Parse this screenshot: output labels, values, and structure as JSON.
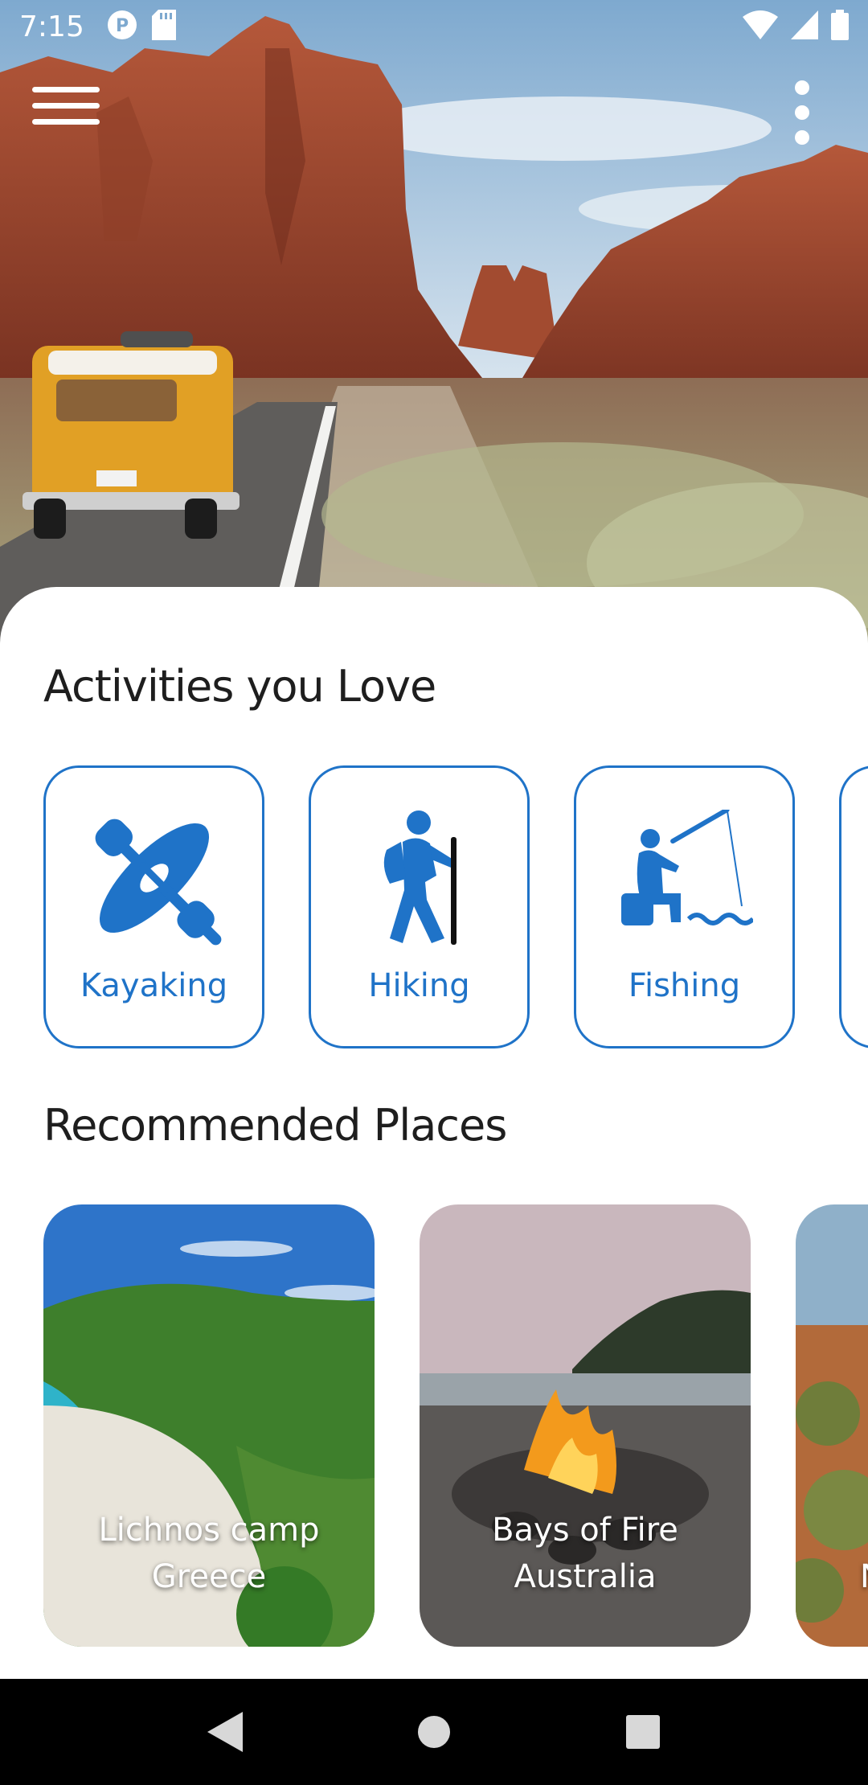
{
  "status_bar": {
    "time": "7:15",
    "icons": [
      "p-notification-icon",
      "sd-card-icon",
      "wifi-icon",
      "signal-icon",
      "battery-icon"
    ]
  },
  "colors": {
    "accent": "#1f73c8",
    "text": "#1e1e1e",
    "sheet": "#ffffff"
  },
  "sections": {
    "activities_title": "Activities you Love",
    "places_title": "Recommended Places"
  },
  "activities": [
    {
      "label": "Kayaking",
      "icon": "kayak-icon"
    },
    {
      "label": "Hiking",
      "icon": "hiker-icon"
    },
    {
      "label": "Fishing",
      "icon": "fishing-icon"
    }
  ],
  "places": [
    {
      "name_line1": "Lichnos camp",
      "name_line2": "Greece"
    },
    {
      "name_line1": "Bays of Fire",
      "name_line2": "Australia"
    },
    {
      "name_line1": "N",
      "name_line2": ""
    }
  ],
  "nav": [
    "back-icon",
    "home-icon",
    "recents-icon"
  ]
}
